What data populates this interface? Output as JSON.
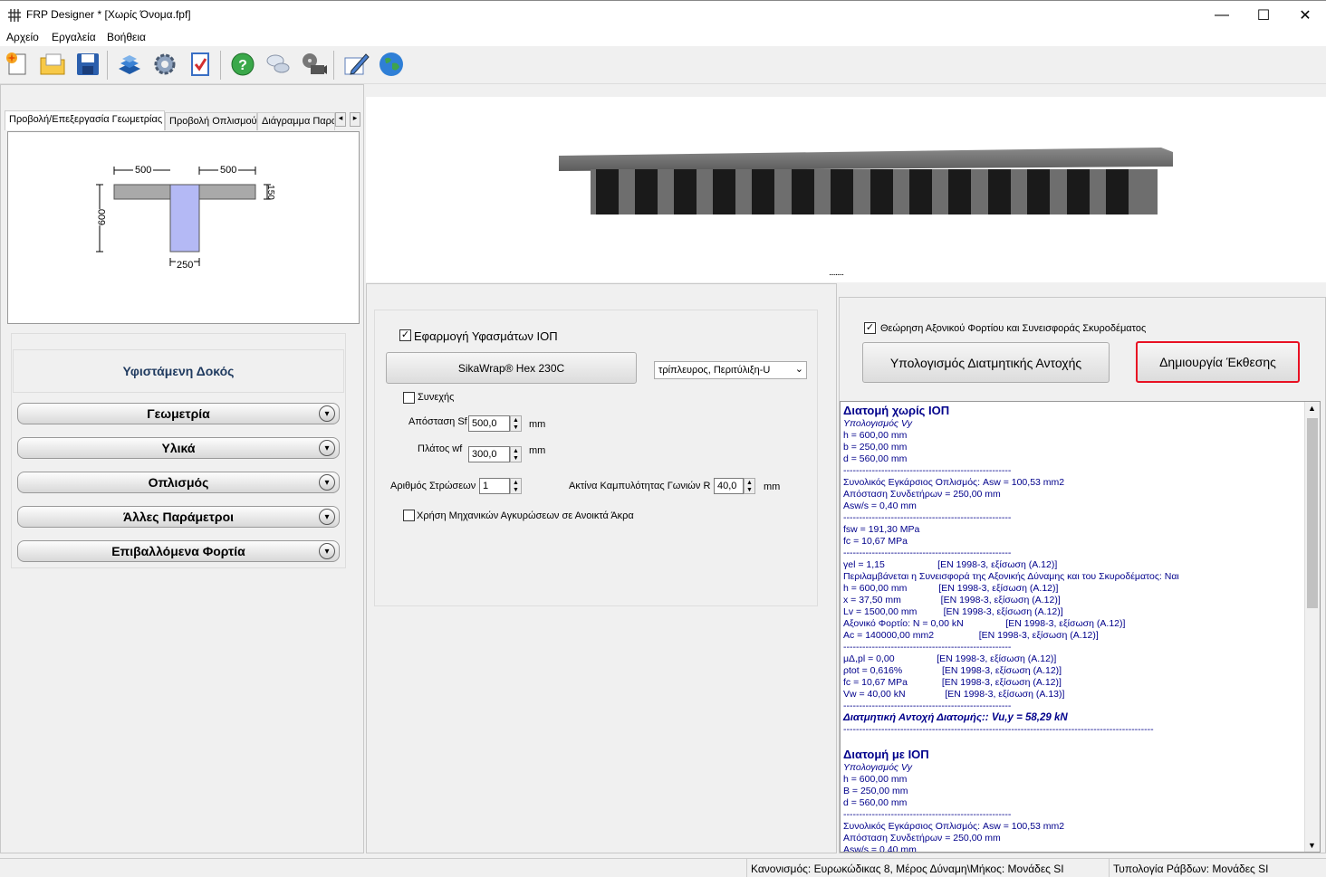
{
  "window": {
    "title": "FRP Designer * [Χωρίς Όνομα.fpf]",
    "minimize": "—",
    "maximize": "☐",
    "close": "✕"
  },
  "menu": [
    "Αρχείο",
    "Εργαλεία",
    "Βοήθεια"
  ],
  "toolbar": {
    "icons": [
      "new-file-icon",
      "open-folder-icon",
      "save-icon",
      "book-icon",
      "settings-gear-icon",
      "checklist-icon",
      "help-icon",
      "chat-icon",
      "film-reel-icon",
      "edit-pen-icon",
      "globe-icon"
    ]
  },
  "tabs": {
    "items": [
      "Προβολή/Επεξεργασία Γεωμετρίας",
      "Προβολή Οπλισμού",
      "Διάγραμμα Παρα"
    ],
    "scroll_left": "◂",
    "scroll_right": "▸"
  },
  "section": {
    "dims": {
      "top_left": "500",
      "top_right": "500",
      "flange": "150",
      "height": "600",
      "web": "250"
    }
  },
  "sidebar": {
    "header": "Υφιστάμενη Δοκός",
    "buttons": [
      "Γεωμετρία",
      "Υλικά",
      "Οπλισμός",
      "Άλλες Παράμετροι",
      "Επιβαλλόμενα Φορτία"
    ],
    "chevron": "▾"
  },
  "viewer": {
    "handle": "........."
  },
  "frp": {
    "apply_label": "Εφαρμογή Υφασμάτων ΙΟΠ",
    "apply_checked": "✓",
    "material_button": "SikaWrap® Hex 230C",
    "wrap_select": "τρίπλευρος, Περιτύλιξη-U",
    "continuous_label": "Συνεχής",
    "spacing_label": "Απόσταση Sf",
    "spacing_value": "500,0",
    "width_label": "Πλάτος wf",
    "width_value": "300,0",
    "unit_mm": "mm",
    "layers_label": "Αριθμός Στρώσεων",
    "layers_value": "1",
    "radius_label": "Ακτίνα Καμπυλότητας Γωνιών R",
    "radius_value": "40,0",
    "anchors_label": "Χρήση Μηχανικών Αγκυρώσεων σε Ανοικτά Άκρα"
  },
  "calc": {
    "axial_label": "Θεώρηση Αξονικού Φορτίου και Συνεισφοράς Σκυροδέματος",
    "axial_checked": "✓",
    "compute_button": "Υπολογισμός Διατμητικής Αντοχής",
    "report_button": "Δημιουργία Έκθεσης",
    "report_button_border": "#e81123"
  },
  "report": {
    "h1": "Διατομή χωρίς ΙΟΠ",
    "sub1": "Υπολογισμός Vy",
    "h_val": "h = 600,00 mm",
    "b_val": "b = 250,00 mm",
    "d_val": "d = 560,00 mm",
    "sep": "-----------------------------------------------------",
    "asw": "Συνολικός Εγκάρσιος Οπλισμός: Asw = 100,53 mm2",
    "stirrup": "Απόσταση Συνδετήρων = 250,00 mm",
    "asws": "Asw/s = 0,40 mm",
    "fsw": "fsw = 191,30 MPa",
    "fc": "fc = 10,67 MPa",
    "yel": "γel = 1,15                    [EN 1998-3, εξίσωση (A.12)]",
    "incl": "Περιλαμβάνεται η Συνεισφορά της Αξονικής Δύναμης και του Σκυροδέματος: Ναι",
    "h2": "h = 600,00 mm            [EN 1998-3, εξίσωση (A.12)]",
    "x": "x = 37,50 mm               [EN 1998-3, εξίσωση (A.12)]",
    "lv": "Lv = 1500,00 mm          [EN 1998-3, εξίσωση (A.12)]",
    "n": "Αξονικό Φορτίο: N = 0,00 kN                [EN 1998-3, εξίσωση (A.12)]",
    "ac": "Ac = 140000,00 mm2                 [EN 1998-3, εξίσωση (A.12)]",
    "mu": "μΔ,pl = 0,00                [EN 1998-3, εξίσωση (A.12)]",
    "ptot": "ρtot = 0,616%               [EN 1998-3, εξίσωση (A.12)]",
    "fc2": "fc = 10,67 MPa             [EN 1998-3, εξίσωση (A.12)]",
    "vw": "Vw = 40,00 kN               [EN 1998-3, εξίσωση (A.13)]",
    "result": "Διατμητική Αντοχή Διατομής:: Vu,y = 58,29 kN",
    "sep_long": "--------------------------------------------------------------------------------------------------",
    "h1b": "Διατομή με ΙΟΠ",
    "sub2": "Υπολογισμός Vy",
    "h_val2": "h = 600,00 mm",
    "B_val2": "B = 250,00 mm",
    "d_val2": "d = 560,00 mm",
    "asw2": "Συνολικός Εγκάρσιος Οπλισμός: Asw = 100,53 mm2",
    "stirrup2": "Απόσταση Συνδετήρων = 250,00 mm",
    "asws2": "Asw/s = 0,40 mm"
  },
  "status": {
    "code": "Κανονισμός: Ευρωκώδικας 8, Μέρος Δύναμη\\Μήκος: Μονάδες SI",
    "bars": "Τυπολογία Ράβδων: Μονάδες SI"
  }
}
